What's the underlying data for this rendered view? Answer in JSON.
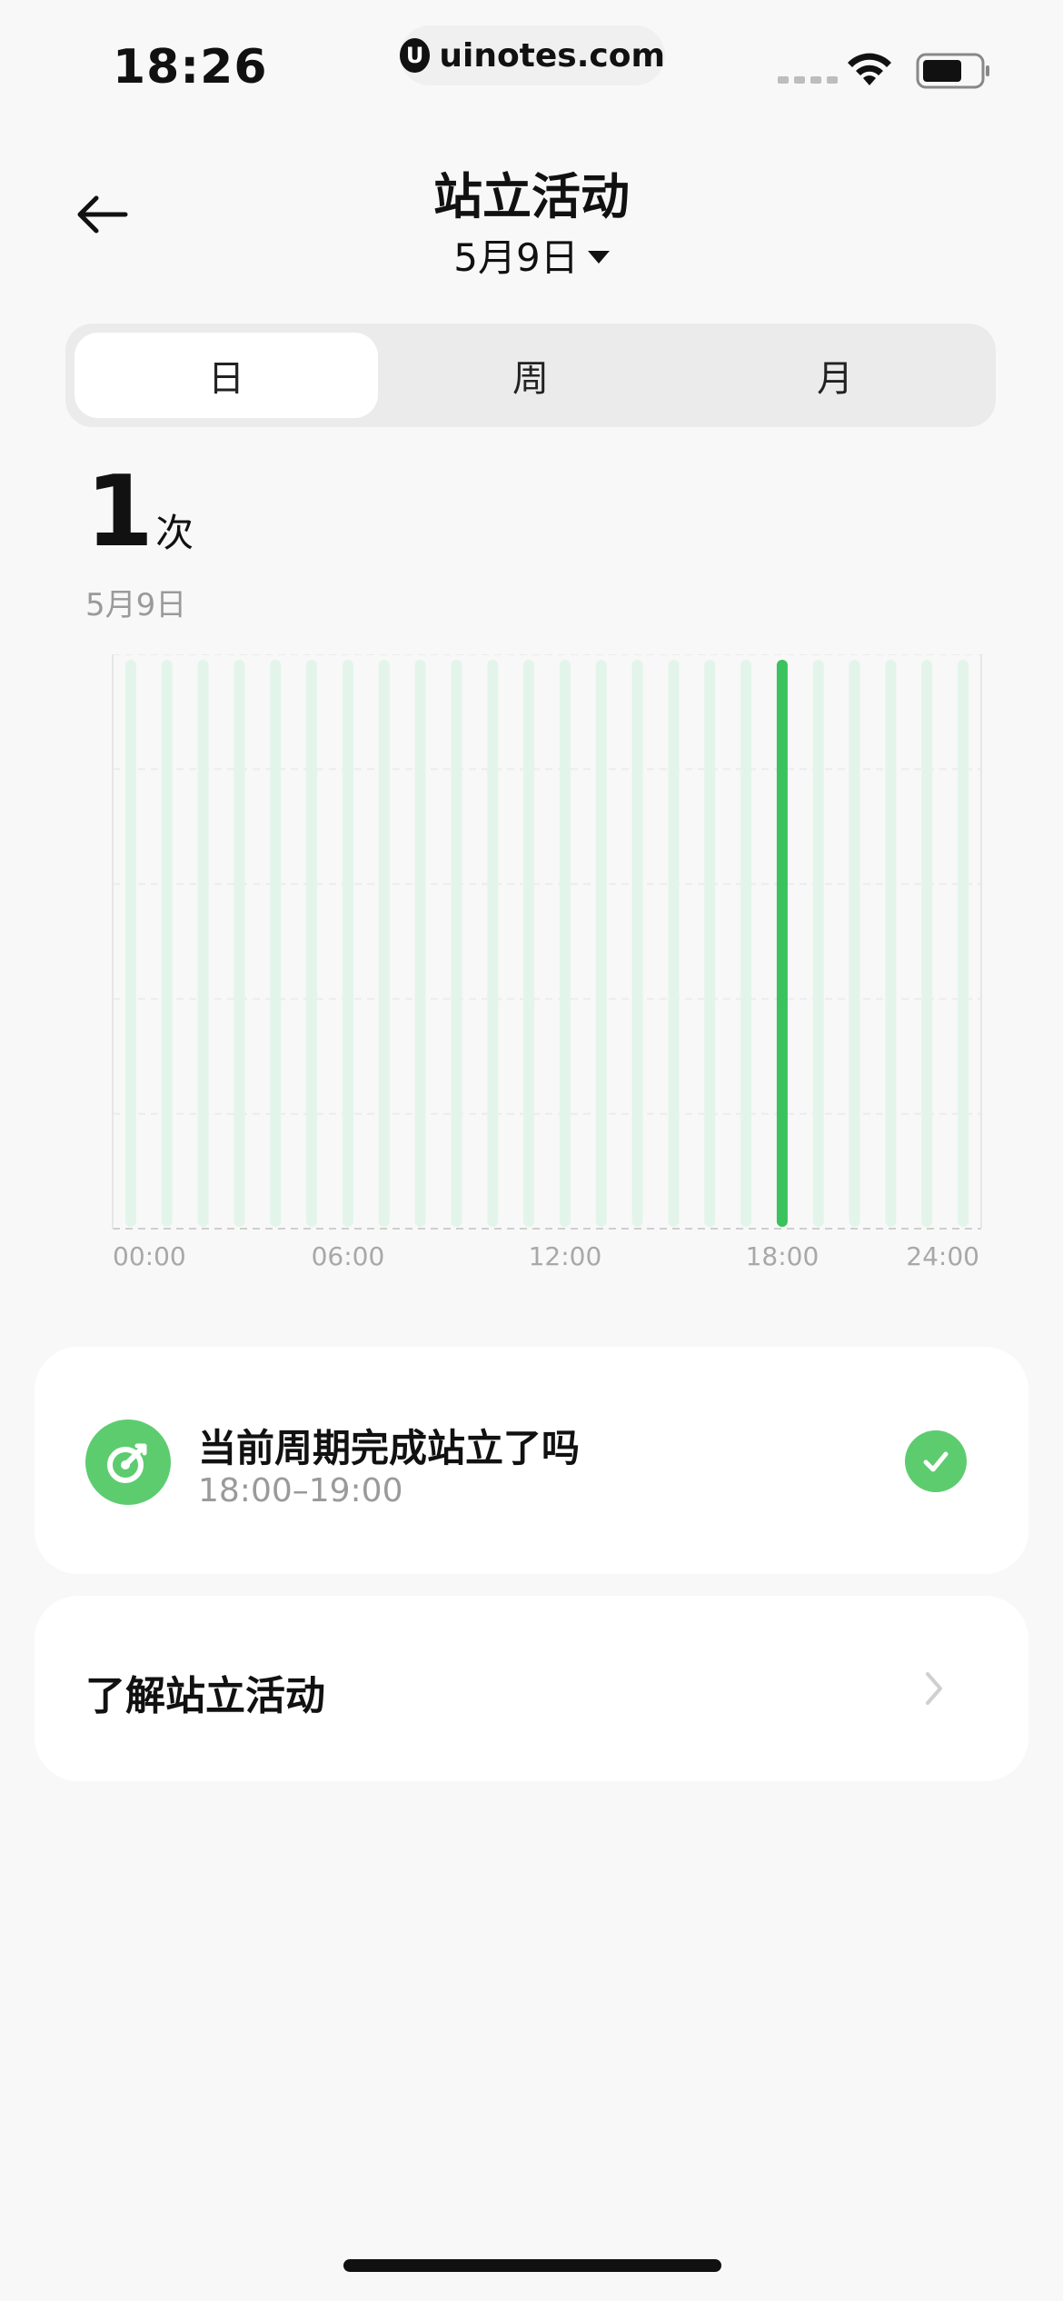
{
  "status_bar": {
    "time": "18:26",
    "url": "uinotes.com"
  },
  "header": {
    "title": "站立活动",
    "date": "5月9日"
  },
  "tabs": [
    {
      "label": "日",
      "active": true
    },
    {
      "label": "周",
      "active": false
    },
    {
      "label": "月",
      "active": false
    }
  ],
  "summary": {
    "count": "1",
    "unit": "次",
    "date": "5月9日"
  },
  "chart_data": {
    "type": "bar",
    "categories": [
      "0",
      "1",
      "2",
      "3",
      "4",
      "5",
      "6",
      "7",
      "8",
      "9",
      "10",
      "11",
      "12",
      "13",
      "14",
      "15",
      "16",
      "17",
      "18",
      "19",
      "20",
      "21",
      "22",
      "23"
    ],
    "values": [
      0,
      0,
      0,
      0,
      0,
      0,
      0,
      0,
      0,
      0,
      0,
      0,
      0,
      0,
      0,
      0,
      0,
      0,
      1,
      0,
      0,
      0,
      0,
      0
    ],
    "x_tick_labels": [
      "00:00",
      "06:00",
      "12:00",
      "18:00",
      "24:00"
    ],
    "ylim": [
      0,
      1
    ],
    "colors": {
      "active": "#39c25e",
      "inactive": "#e3f5ea"
    }
  },
  "status_card": {
    "title": "当前周期完成站立了吗",
    "time_range": "18:00–19:00",
    "completed": true
  },
  "learn_card": {
    "label": "了解站立活动"
  },
  "colors": {
    "accent": "#5dcc6f",
    "background": "#f8f8f8"
  }
}
